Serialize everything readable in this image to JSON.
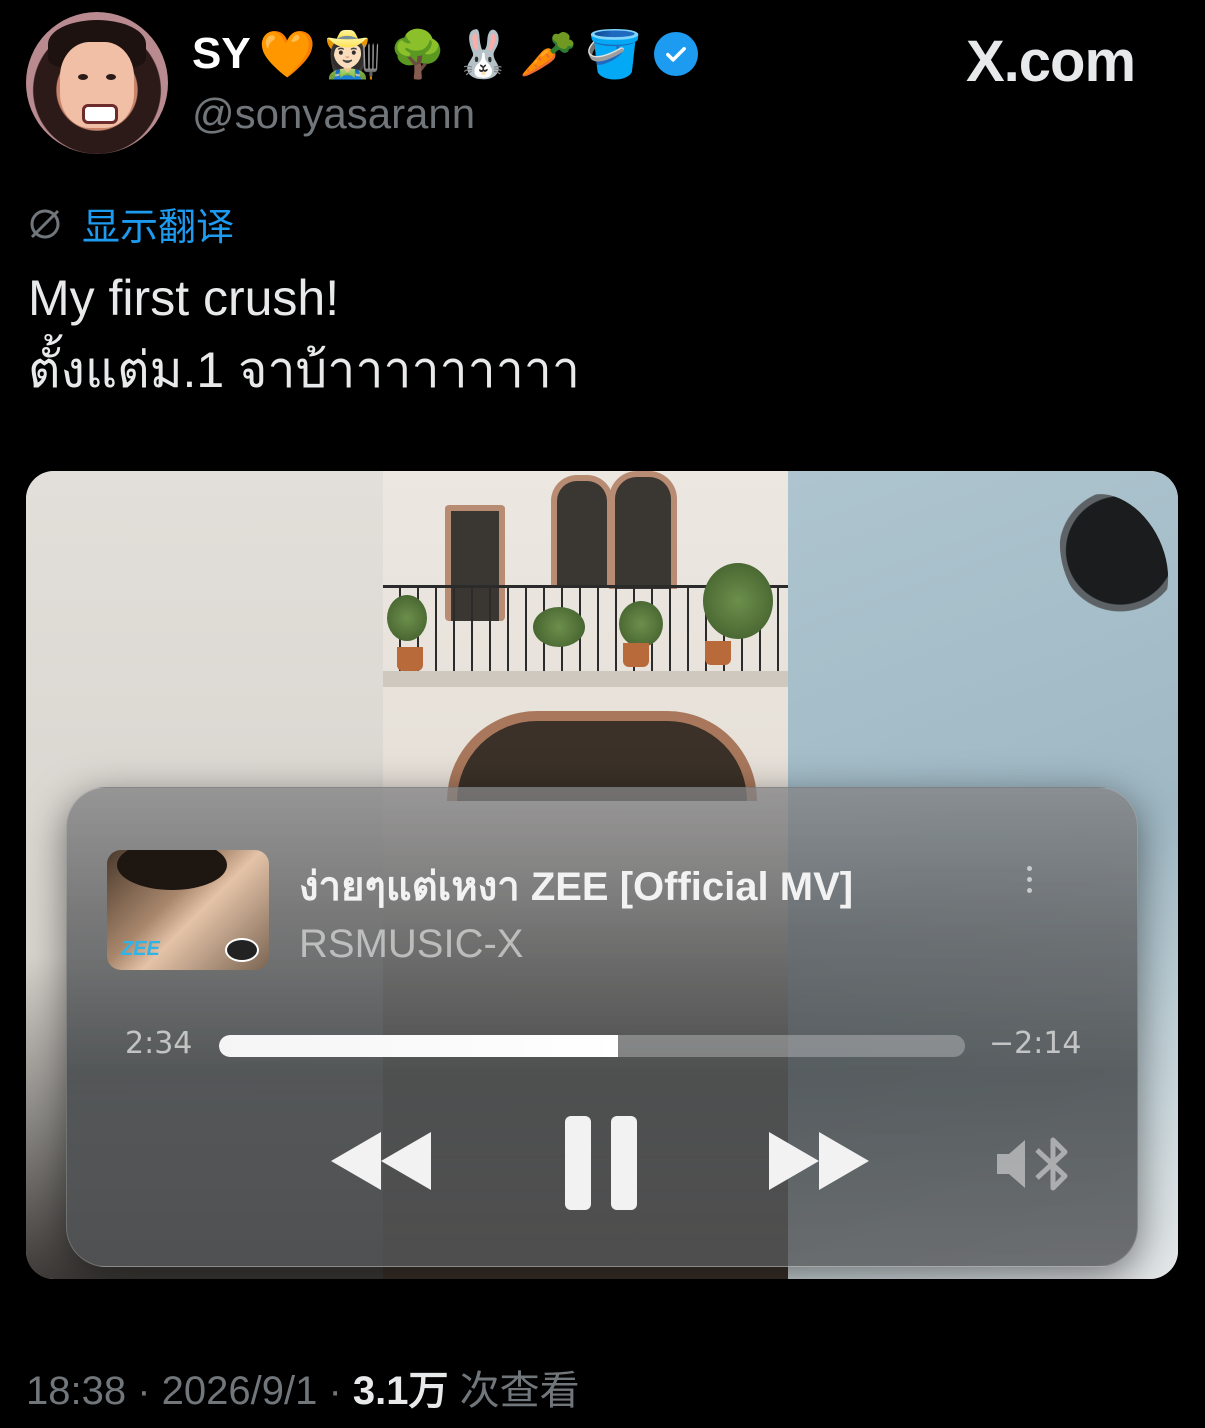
{
  "header": {
    "display_name": "SY",
    "emoji_badges": [
      "🧡",
      "👩🏻‍🌾",
      "🌳",
      "🐰",
      "🥕",
      "🪣"
    ],
    "handle": "@sonyasarann",
    "verified_icon": "verified-badge-icon",
    "watermark": "X.com"
  },
  "translate": {
    "icon": "globe-icon",
    "label": "显示翻译"
  },
  "tweet": {
    "lines": [
      "My first crush!",
      "ตั้งแต่ม.1 จาบ้าาาาาาาาา"
    ]
  },
  "player": {
    "song_title": "ง่ายๆแต่เหงา ZEE [Official MV]",
    "artist": "RSMUSIC-X",
    "album_badge": "ZEE",
    "elapsed": "2:34",
    "remaining": "−2:14",
    "progress": 0.535,
    "controls": [
      "rewind-icon",
      "pause-icon",
      "fast-forward-icon",
      "bluetooth-volume-icon"
    ]
  },
  "footer": {
    "time": "18:38",
    "sep1": " · ",
    "date": "2026/9/1",
    "sep2": " · ",
    "views": "3.1万",
    "views_label": " 次查看"
  },
  "colors": {
    "background": "#000000",
    "text": "#e7e9ea",
    "muted": "#71767b",
    "link": "#1d9bf0"
  }
}
